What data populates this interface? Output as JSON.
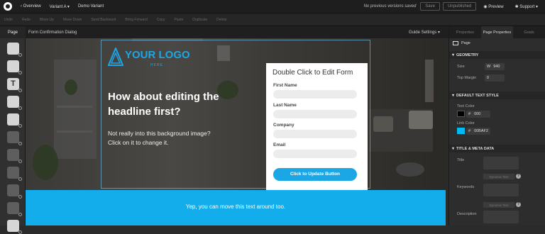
{
  "topbar": {
    "overview": "‹ Overview",
    "variant": "Variant A",
    "variant_caret": "▾",
    "name": "Demo Variant",
    "status": "No previous versions saved",
    "save": "Save",
    "unpublished": "Unpublished",
    "preview": "Preview",
    "support": "Support"
  },
  "toolbar": [
    "Undo",
    "Redo",
    "Move Up",
    "Move Down",
    "Send Backward",
    "Bring Forward",
    "Copy",
    "Paste",
    "Duplicate",
    "Delete"
  ],
  "secbar": {
    "page_tab": "Page",
    "crumb": "Form Confirmation Dialog",
    "guide": "Guide Settings ▾"
  },
  "canvas": {
    "logo_text": "YOUR LOGO",
    "logo_sub": "HERE",
    "headline": "How about editing the headline first?",
    "body": "Not really into this background image? Click on it to change it.",
    "form": {
      "title": "Double Click to Edit Form",
      "fields": [
        "First Name",
        "Last Name",
        "Company",
        "Email"
      ],
      "button": "Click to Update Button"
    },
    "bar_text": "Yep, you can move this text around too."
  },
  "rightpanel": {
    "tabs": [
      "Properties",
      "Page Properties",
      "Goals"
    ],
    "page_label": "Page",
    "geometry": "GEOMETRY",
    "size_label": "Size",
    "size_w": "W",
    "size_value": "940",
    "top_margin_label": "Top Margin",
    "top_margin_value": "0",
    "text_style": "DEFAULT TEXT STYLE",
    "text_color_label": "Text Color",
    "text_color_value": "000",
    "link_color_label": "Link Color",
    "link_color_value": "00BAF2",
    "hash": "#",
    "meta": "TITLE & META DATA",
    "title_label": "Title",
    "keywords_label": "Keywords",
    "description_label": "Description",
    "dynamic_text": "Dynamic Text",
    "help": "?"
  },
  "colors": {
    "accent": "#12adea",
    "text_color": "#000000",
    "link_color": "#00BAF2"
  }
}
